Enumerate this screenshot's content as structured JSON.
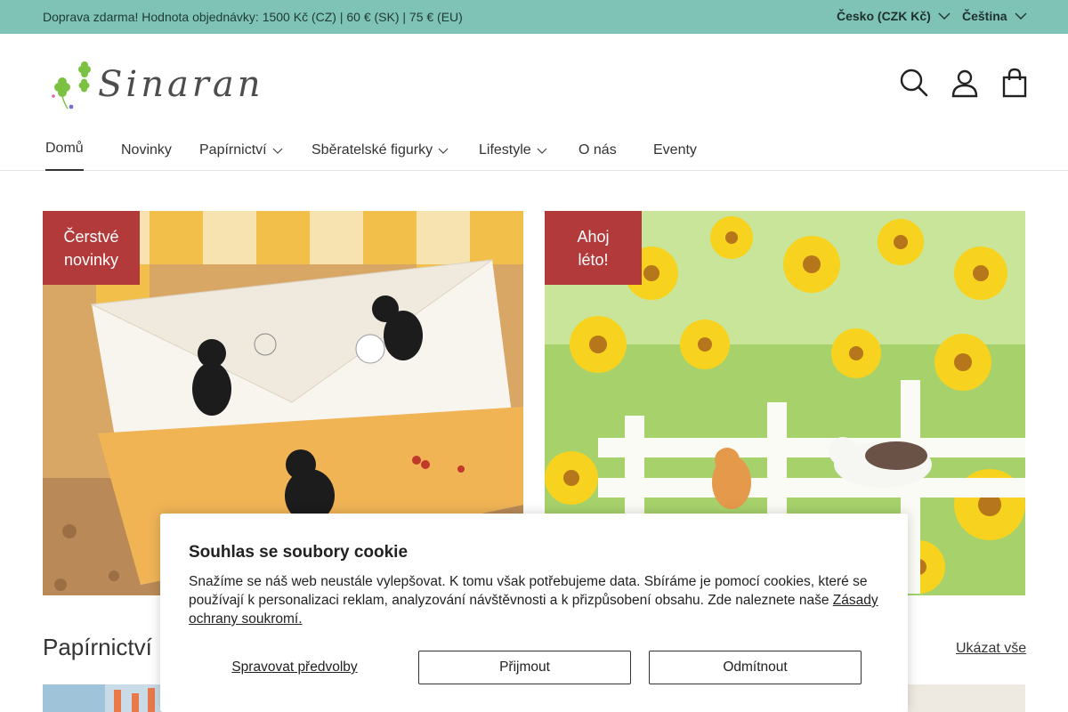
{
  "announcement": {
    "message": "Doprava zdarma! Hodnota objednávky: 1500 Kč (CZ) | 60 € (SK) | 75 € (EU)",
    "country": "Česko (CZK Kč)",
    "language": "Čeština"
  },
  "brand": {
    "logo_text": "Sinaran"
  },
  "header_icons": [
    "search-icon",
    "account-icon",
    "bag-icon"
  ],
  "nav": {
    "items": [
      {
        "label": "Domů",
        "active": true,
        "dropdown": false
      },
      {
        "label": "Novinky",
        "dropdown": false
      },
      {
        "label": "Papírnictví",
        "dropdown": true
      },
      {
        "label": "Sběratelské figurky",
        "dropdown": true
      },
      {
        "label": "Lifestyle",
        "dropdown": true
      },
      {
        "label": "O nás",
        "dropdown": false
      },
      {
        "label": "Eventy",
        "dropdown": false
      }
    ]
  },
  "banners": [
    {
      "badge_line1": "Čerstvé",
      "badge_line2": "novinky"
    },
    {
      "badge_line1": "Ahoj",
      "badge_line2": "léto!"
    }
  ],
  "collection": {
    "title": "Papírnictví",
    "view_all": "Ukázat vše"
  },
  "cookie": {
    "title": "Souhlas se soubory cookie",
    "text": "Snažíme se náš web neustále vylepšovat. K tomu však potřebujeme data. Sbíráme je pomocí cookies, které se používají k personalizaci reklam, analyzování návštěvnosti a k přizpůsobení obsahu. Zde naleznete naše",
    "privacy_link": "Zásady ochrany soukromí.",
    "manage": "Spravovat předvolby",
    "accept": "Přijmout",
    "reject": "Odmítnout"
  },
  "colors": {
    "announcement_bg": "#7fc3b6",
    "badge_bg": "#b23a3a"
  }
}
